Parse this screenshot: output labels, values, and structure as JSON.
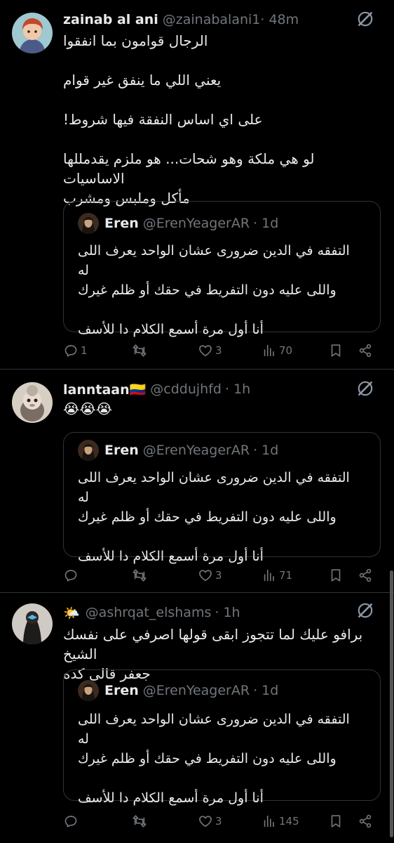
{
  "tweets": [
    {
      "name": "zainab al ani",
      "handle": "@zainabalani1",
      "time": "· 48m",
      "lines": [
        "الرجال قوامون بما انفقوا",
        "",
        "يعني اللي ما ينفق غير قوام",
        "",
        "على اي اساس النفقة فيها شروط!",
        "",
        "لو هي ملكة وهو شحات... هو ملزم يقدمللها الاساسيات",
        "مأكل وملبس ومشرب"
      ],
      "quote": {
        "name": "Eren",
        "handle": "@ErenYeagerAR",
        "time": "· 1d",
        "line1": "التفقه في الدين ضرورى عشان الواحد يعرف اللى له",
        "line2": "واللى عليه دون التفريط في حقك أو ظلم غيرك",
        "line3": "أنا أول مرة أسمع الكلام دا للأسف"
      },
      "replies": "1",
      "retweets": "",
      "likes": "3",
      "views": "70"
    },
    {
      "name": "lanntaan⁢🇨🇴",
      "handle": "@cddujhfd",
      "time": "· 1h",
      "lines": [
        "😭😭😭"
      ],
      "quote": {
        "name": "Eren",
        "handle": "@ErenYeagerAR",
        "time": "· 1d",
        "line1": "التفقه في الدين ضرورى عشان الواحد يعرف اللى له",
        "line2": "واللى عليه دون التفريط في حقك أو ظلم غيرك",
        "line3": "أنا أول مرة أسمع الكلام دا للأسف"
      },
      "replies": "",
      "retweets": "",
      "likes": "3",
      "views": "71"
    },
    {
      "name": "🌤️",
      "handle": "@ashrqat_elshams",
      "time": "· 1h",
      "lines": [
        "برافو عليك لما تتجوز ابقى قولها اصرفي على نفسك الشيخ",
        "جعفر قالى كده"
      ],
      "quote": {
        "name": "Eren",
        "handle": "@ErenYeagerAR",
        "time": "· 1d",
        "line1": "التفقه في الدين ضرورى عشان الواحد يعرف اللى له",
        "line2": "واللى عليه دون التفريط في حقك أو ظلم غيرك",
        "line3": "أنا أول مرة أسمع الكلام دا للأسف"
      },
      "replies": "",
      "retweets": "",
      "likes": "3",
      "views": "145"
    }
  ],
  "icons": [
    "grok-icon",
    "reply-icon",
    "retweet-icon",
    "like-icon",
    "views-icon",
    "bookmark-icon",
    "share-icon"
  ]
}
